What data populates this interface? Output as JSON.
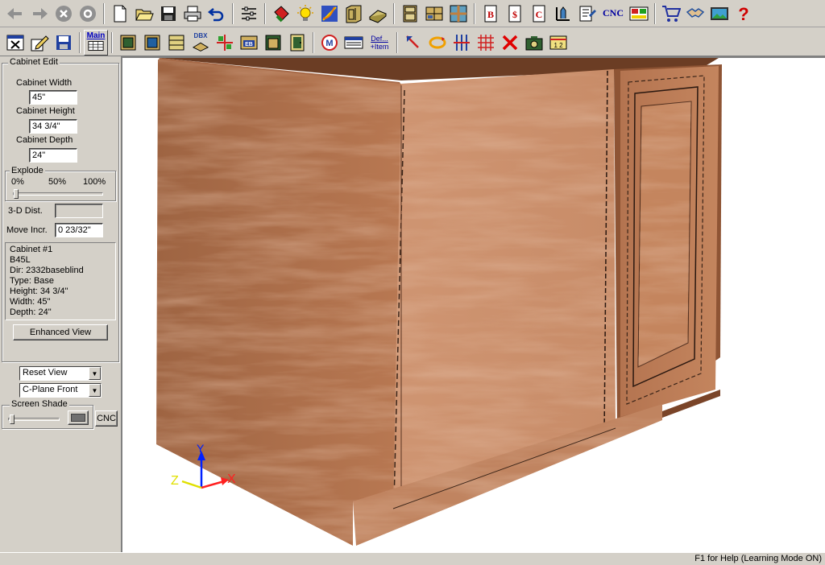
{
  "toolbar_top": {
    "cnc_label": "CNC",
    "icons": [
      "back-arrow-icon",
      "forward-arrow-icon",
      "stop-icon",
      "refresh-icon",
      "new-file-icon",
      "open-folder-icon",
      "save-icon",
      "print-icon",
      "undo-icon",
      "settings-sliders-icon",
      "paint-bucket-icon",
      "lightbulb-icon",
      "graph-icon",
      "door-style-icon",
      "board-icon",
      "cabinet-icon",
      "multi-cabinet-icon",
      "texture-icon",
      "bid-report-icon",
      "price-report-icon",
      "cut-report-icon",
      "elevation-icon",
      "properties-icon",
      "cnc-icon",
      "layout-icon",
      "cart-icon",
      "handshake-icon",
      "photo-icon",
      "help-icon"
    ]
  },
  "toolbar_second": {
    "main_label": "Main",
    "def_item_top": "Def...",
    "def_item_bottom": "+Item",
    "dbx_label": "DBX",
    "eb_label": "EB"
  },
  "panel": {
    "cabinet_edit_title": "Cabinet Edit",
    "width_label": "Cabinet Width",
    "width_value": "45\"",
    "height_label": "Cabinet Height",
    "height_value": "34 3/4\"",
    "depth_label": "Cabinet Depth",
    "depth_value": "24\"",
    "explode_title": "Explode",
    "explode_ticks": [
      "0%",
      "50%",
      "100%"
    ],
    "explode_value": 0,
    "dist_label": "3-D Dist.",
    "dist_value": "",
    "move_label": "Move Incr.",
    "move_value": "0 23/32\"",
    "info_lines": [
      "Cabinet #1",
      "B45L",
      "Dir: 2332baseblind",
      "Type: Base",
      "Height: 34 3/4\"",
      "Width: 45\"",
      "Depth: 24\""
    ],
    "enhanced_view_label": "Enhanced View",
    "reset_view_value": "Reset View",
    "cplane_value": "C-Plane Front",
    "screen_shade_title": "Screen Shade",
    "cnc_button_label": "CNC"
  },
  "axis": {
    "x": "X",
    "y": "Y",
    "z": "Z"
  },
  "status": {
    "help_text": "F1 for Help (Learning Mode ON)"
  },
  "colors": {
    "wood_light": "#c98a63",
    "wood_dark": "#9c5c3c",
    "chrome": "#d4d0c8"
  }
}
